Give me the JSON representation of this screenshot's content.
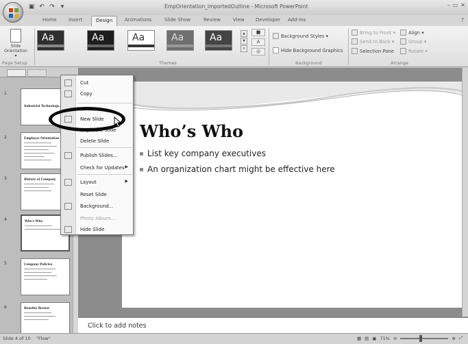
{
  "window": {
    "title": "EmpOrientation_importedOutline - Microsoft PowerPoint",
    "controls": [
      "–",
      "▭",
      "✕"
    ]
  },
  "ribbon_tabs": [
    "Home",
    "Insert",
    "Design",
    "Animations",
    "Slide Show",
    "Review",
    "View",
    "Developer",
    "Add-Ins"
  ],
  "active_tab": "Design",
  "ribbon": {
    "page_setup": {
      "slide_orientation": "Slide Orientation ▾",
      "group_label": "Page Setup"
    },
    "themes": {
      "thumb_label": "Aa",
      "group_label": "Themes",
      "colors": [
        "#2f2f2f",
        "#1e1e1e",
        "#ffffff",
        "#6f6f6f",
        "#444444"
      ]
    },
    "background": {
      "styles": "Background Styles ▾",
      "hide_graphics": "Hide Background Graphics",
      "group_label": "Background"
    },
    "arrange": {
      "bring_to_front": "Bring to Front ▾",
      "send_to_back": "Send to Back ▾",
      "selection_pane": "Selection Pane",
      "align": "Align ▾",
      "group": "Group ▾",
      "rotate": "Rotate ▾",
      "group_label": "Arrange"
    }
  },
  "thumbnails": [
    {
      "num": "1",
      "title": "Industrial Technology..."
    },
    {
      "num": "2",
      "title": "Employee Orientation"
    },
    {
      "num": "3",
      "title": "History of Company"
    },
    {
      "num": "4",
      "title": "Who's Who"
    },
    {
      "num": "5",
      "title": "Company Policies"
    },
    {
      "num": "6",
      "title": "Benefits Review"
    }
  ],
  "context_menu": {
    "items": [
      {
        "label": "Cut",
        "enabled": true
      },
      {
        "label": "Copy",
        "enabled": true
      },
      {
        "label": "New Slide",
        "enabled": true
      },
      {
        "label": "Duplicate Slide",
        "enabled": true
      },
      {
        "label": "Delete Slide",
        "enabled": true
      },
      {
        "label": "Publish Slides...",
        "enabled": true
      },
      {
        "label": "Check for Updates",
        "enabled": true,
        "submenu": true
      },
      {
        "label": "Layout",
        "enabled": true,
        "submenu": true
      },
      {
        "label": "Reset Slide",
        "enabled": true
      },
      {
        "label": "Background...",
        "enabled": true
      },
      {
        "label": "Photo Album...",
        "enabled": false
      },
      {
        "label": "Hide Slide",
        "enabled": true
      }
    ]
  },
  "slide": {
    "title": "Who’s Who",
    "bullets": [
      "List key company executives",
      "An organization chart might be effective here"
    ]
  },
  "notes_placeholder": "Click to add notes",
  "status": {
    "slide_info": "Slide 4 of 10",
    "theme": "\"Flow\"",
    "zoom": "71%"
  }
}
